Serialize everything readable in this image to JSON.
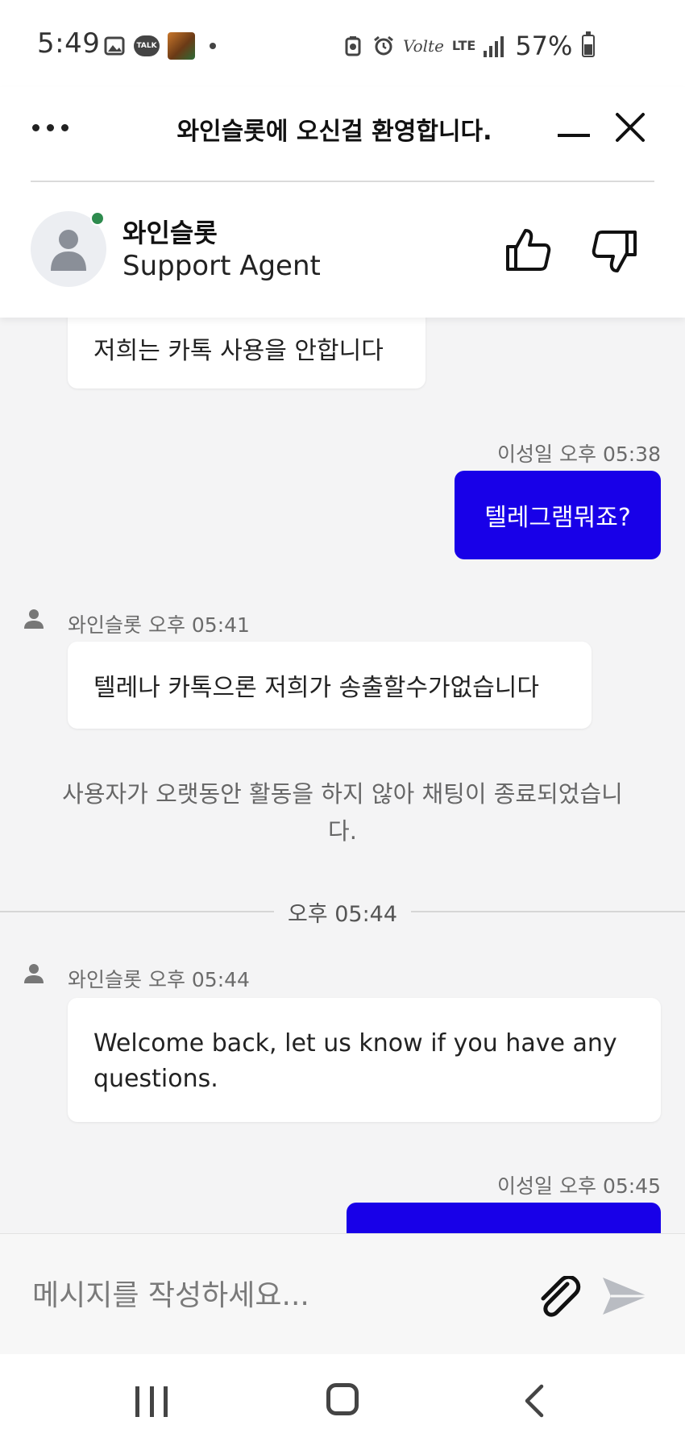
{
  "status_bar": {
    "time": "5:49",
    "talk_badge": "TALK",
    "volte": "Volte",
    "lte": "LTE",
    "battery": "57%"
  },
  "header": {
    "title": "와인슬롯에 오신걸 환영합니다."
  },
  "agent": {
    "name": "와인슬롯",
    "role": "Support Agent",
    "status": "online"
  },
  "messages": [
    {
      "from": "agent",
      "text": "저희는 카톡 사용을 안합니다"
    },
    {
      "from": "user",
      "meta": "이성일 오후 05:38",
      "text": "텔레그램뭐죠?"
    },
    {
      "from": "agent",
      "meta": "와인슬롯 오후 05:41",
      "text": "텔레나 카톡으론 저희가 송출할수가없습니다"
    },
    {
      "from": "system",
      "text": "사용자가 오랫동안 활동을 하지 않아 채팅이 종료되었습니다."
    },
    {
      "from": "separator",
      "text": "오후 05:44"
    },
    {
      "from": "agent",
      "meta": "와인슬롯 오후 05:44",
      "text": "Welcome back, let us know if you have any questions."
    },
    {
      "from": "user",
      "meta": "이성일 오후 05:45",
      "text": ""
    }
  ],
  "composer": {
    "placeholder": "메시지를 작성하세요..."
  },
  "colors": {
    "user_bubble": "#1800e8",
    "online": "#2e8b4e",
    "background": "#f4f4f5"
  }
}
